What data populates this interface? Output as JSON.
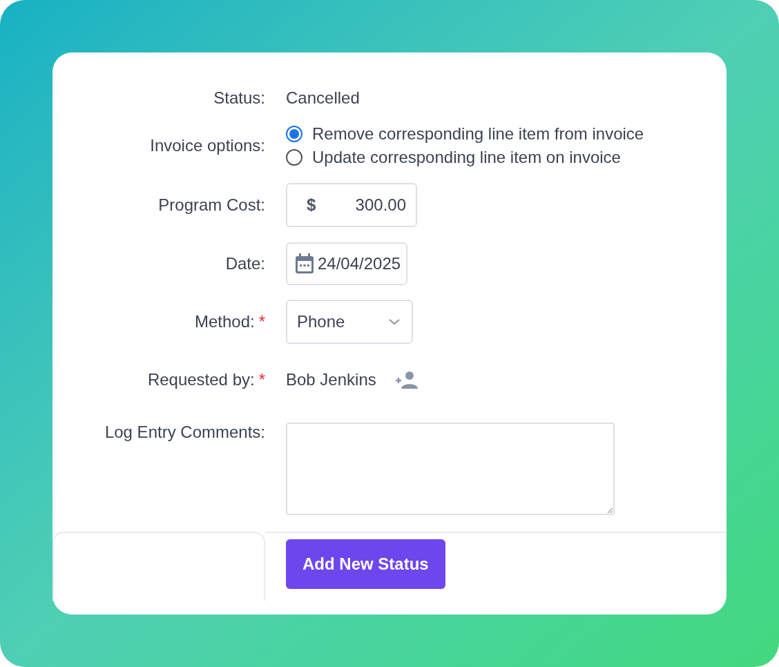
{
  "status": {
    "label": "Status:",
    "value": "Cancelled"
  },
  "invoice_options": {
    "label": "Invoice options:",
    "options": [
      {
        "label": "Remove corresponding line item from invoice",
        "selected": true
      },
      {
        "label": "Update corresponding line item on invoice",
        "selected": false
      }
    ]
  },
  "program_cost": {
    "label": "Program Cost:",
    "currency": "$",
    "value": "300.00"
  },
  "date": {
    "label": "Date:",
    "value": "24/04/2025"
  },
  "method": {
    "label": "Method:",
    "required_mark": "*",
    "value": "Phone"
  },
  "requested_by": {
    "label": "Requested by:",
    "required_mark": "*",
    "value": "Bob Jenkins"
  },
  "comments": {
    "label": "Log Entry Comments:"
  },
  "submit_button": "Add New Status"
}
